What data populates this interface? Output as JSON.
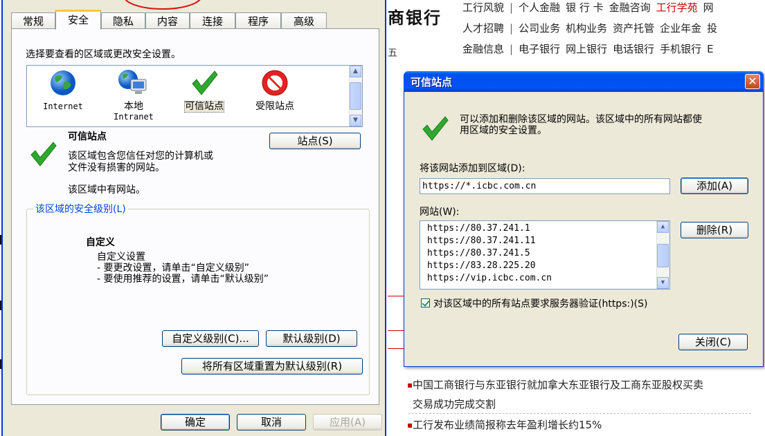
{
  "background": {
    "bank_name": "商银行",
    "nav_row1": [
      "工行风貌",
      "个人金融",
      "银 行 卡",
      "金融咨询",
      "工行学苑",
      "网"
    ],
    "nav_row2": [
      "人才招聘",
      "公司业务",
      "机构业务",
      "资产托管",
      "企业年金",
      "投"
    ],
    "nav_row3": [
      "金融信息",
      "电子银行",
      "网上银行",
      "电话银行",
      "手机银行",
      "E"
    ],
    "stray_letter": "五",
    "news": [
      "中国工商银行与东亚银行就加拿大东亚银行及工商东亚股权买卖",
      "交易成功完成交割",
      "工行发布业绩简报称去年盈利增长约15%"
    ]
  },
  "options_dialog": {
    "tabs": [
      "常规",
      "安全",
      "隐私",
      "内容",
      "连接",
      "程序",
      "高级"
    ],
    "active_tab": "安全",
    "prompt": "选择要查看的区域或更改安全设置。",
    "zones": [
      {
        "label": "Internet",
        "label2": ""
      },
      {
        "label": "本地",
        "label2": "Intranet"
      },
      {
        "label": "可信站点",
        "label2": ""
      },
      {
        "label": "受限站点",
        "label2": ""
      }
    ],
    "zone_title": "可信站点",
    "zone_desc_line1": "该区域包含您信任对您的计算机或",
    "zone_desc_line2": "文件没有损害的网站。",
    "zone_has_sites": "该区域中有网站。",
    "sites_button": "站点(S)",
    "security_level_group": "该区域的安全级别(L)",
    "level_name": "自定义",
    "level_desc": [
      "自定义设置",
      "- 要更改设置，请单击“自定义级别”",
      "- 要使用推荐的设置，请单击“默认级别”"
    ],
    "custom_level_button": "自定义级别(C)...",
    "default_level_button": "默认级别(D)",
    "reset_all_button": "将所有区域重置为默认级别(R)",
    "ok_button": "确定",
    "cancel_button": "取消",
    "apply_button": "应用(A)"
  },
  "trusted_dialog": {
    "title": "可信站点",
    "close_glyph": "✕",
    "info_line1": "可以添加和删除该区域的网站。该区域中的所有网站都使",
    "info_line2": "用区域的安全设置。",
    "add_label": "将该网站添加到区域(D):",
    "add_value": "https://*.icbc.com.cn",
    "add_button": "添加(A)",
    "sites_label": "网站(W):",
    "sites": [
      "https://80.37.241.1",
      "https://80.37.241.11",
      "https://80.37.241.5",
      "https://83.28.225.20",
      "https://vip.icbc.com.cn"
    ],
    "remove_button": "删除(R)",
    "verify_label": "对该区域中的所有站点要求服务器验证(https:)(S)",
    "verify_checked": true,
    "close_button": "关闭(C)"
  }
}
